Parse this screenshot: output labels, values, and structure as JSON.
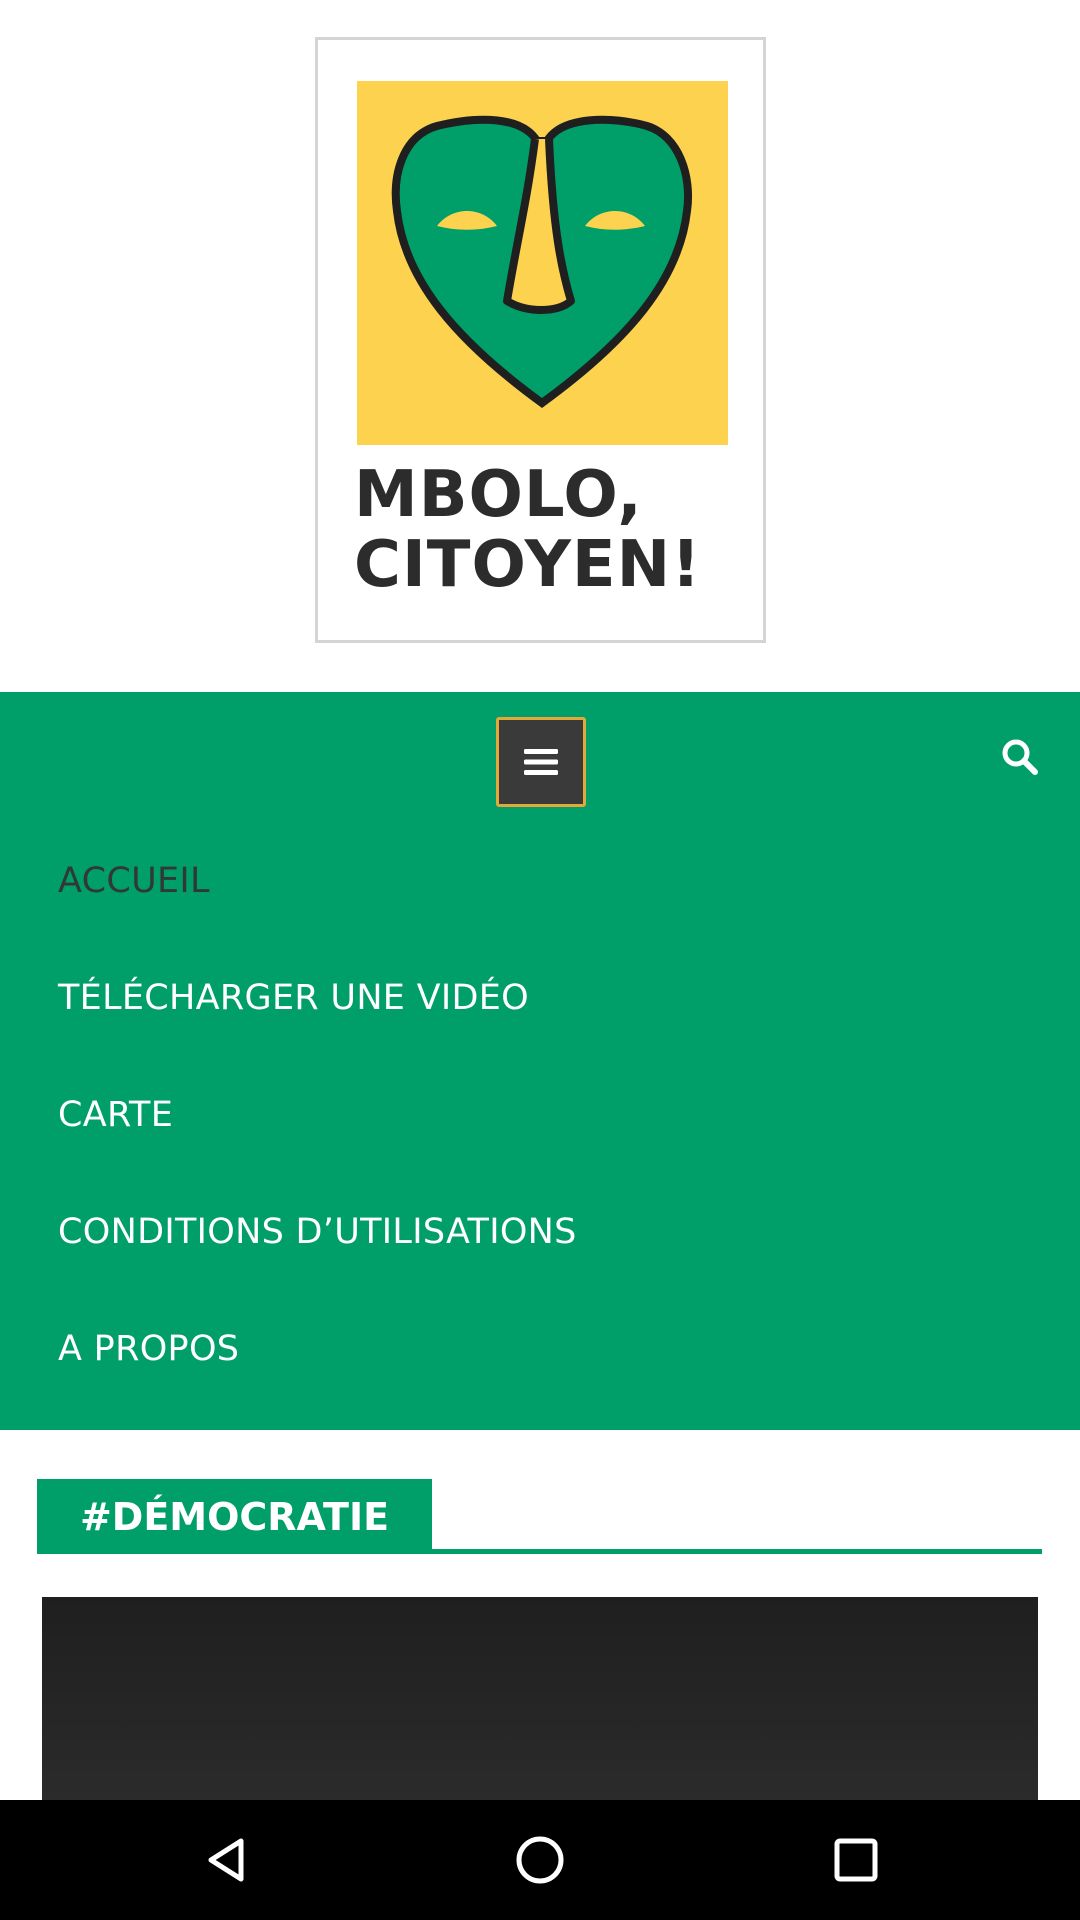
{
  "logo": {
    "line1": "MBOLO,",
    "line2": "CITOYEN!",
    "icon": "mask-logo"
  },
  "nav": {
    "menu_icon": "hamburger-icon",
    "search_icon": "search-icon",
    "items": [
      {
        "label": "ACCUEIL",
        "active": true
      },
      {
        "label": "TÉLÉCHARGER UNE VIDÉO",
        "active": false
      },
      {
        "label": "CARTE",
        "active": false
      },
      {
        "label": "CONDITIONS D’UTILISATIONS",
        "active": false
      },
      {
        "label": "A PROPOS",
        "active": false
      }
    ]
  },
  "section": {
    "title": "#DÉMOCRATIE"
  },
  "system_nav": {
    "back_icon": "back-icon",
    "home_icon": "home-icon",
    "recents_icon": "recents-icon"
  },
  "colors": {
    "brand_green": "#009F6A",
    "logo_yellow": "#FCD24F",
    "menu_toggle_border": "#E0A93A"
  }
}
